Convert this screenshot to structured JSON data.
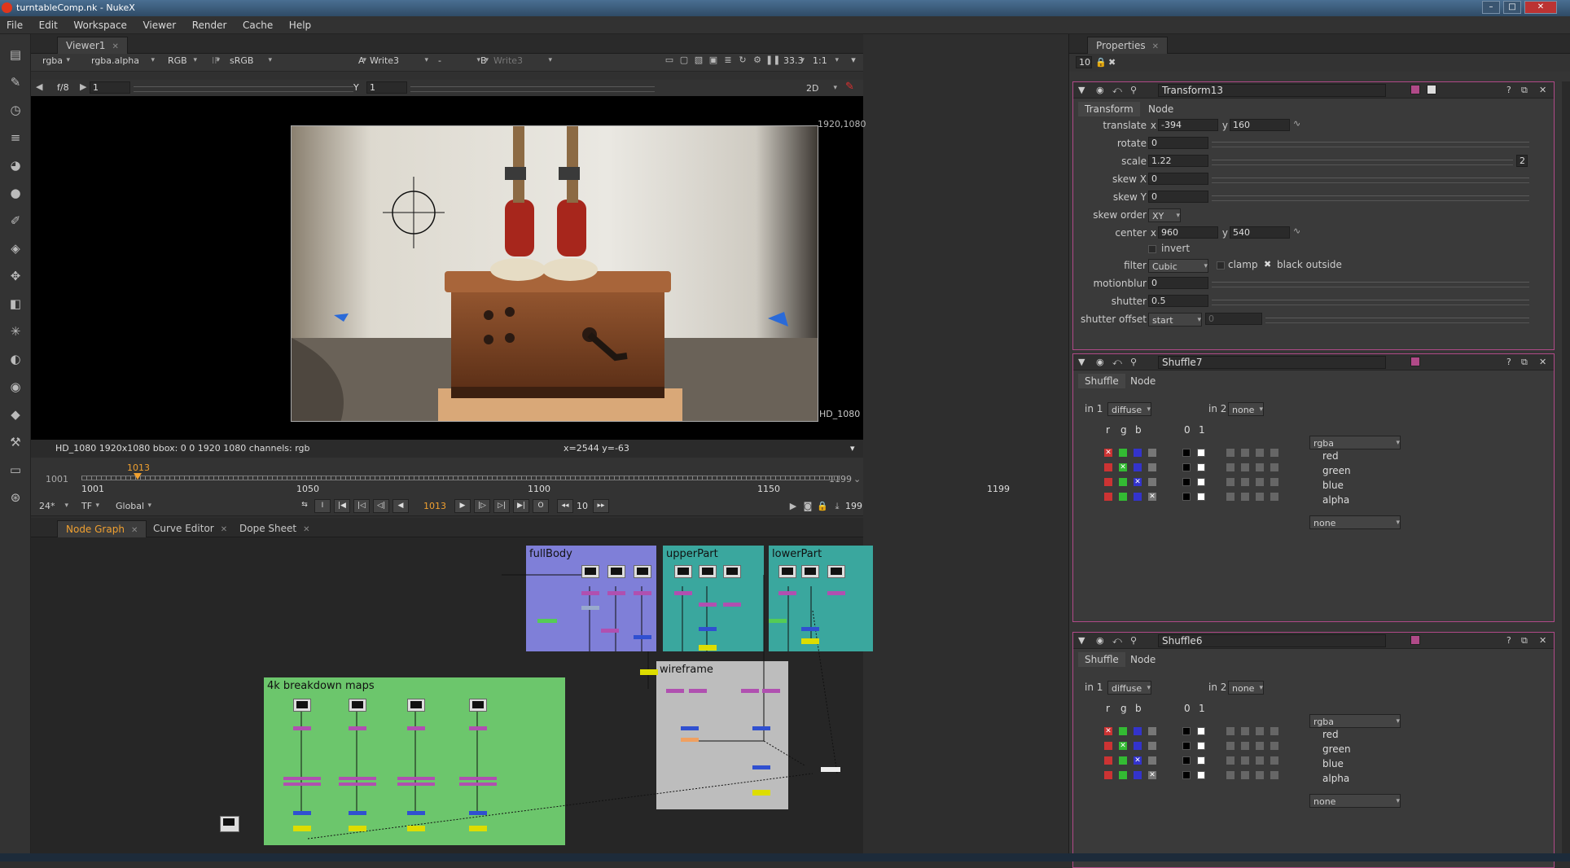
{
  "window": {
    "title": "turntableComp.nk - NukeX",
    "controls": [
      "–",
      "□",
      "✕"
    ]
  },
  "menu": [
    "File",
    "Edit",
    "Workspace",
    "Viewer",
    "Render",
    "Cache",
    "Help"
  ],
  "viewer": {
    "tab": "Viewer1",
    "channels": "rgba",
    "alpha": "rgba.alpha",
    "color": "RGB",
    "ip": "IP",
    "lut": "sRGB",
    "a_label": "A",
    "a_input": "Write3",
    "dash": "-",
    "b_label": "B",
    "b_input": "Write3",
    "zoom": "33.3",
    "ratio": "1:1",
    "fstop": "f/8",
    "gain": "1",
    "gamma_label": "Y",
    "gamma": "1",
    "view_mode": "2D",
    "format_top": "1920,1080",
    "format_bottom": "HD_1080",
    "info": "HD_1080 1920x1080  bbox: 0 0 1920 1080 channels: rgb",
    "coords": "x=2544 y=-63"
  },
  "timeline": {
    "start": "1001",
    "end": "1199",
    "current": "1013",
    "ticks": [
      "1001",
      "1050",
      "1100",
      "1150",
      "1199"
    ],
    "fps": "24*",
    "tf": "TF",
    "range_mode": "Global",
    "increment": "10",
    "frame_count": "199"
  },
  "bottom_tabs": [
    "Node Graph",
    "Curve Editor",
    "Dope Sheet"
  ],
  "backdrops": [
    {
      "label": "fullBody",
      "color": "#7f7fd8"
    },
    {
      "label": "upperPart",
      "color": "#3aa79e"
    },
    {
      "label": "lowerPart",
      "color": "#3aa79e"
    },
    {
      "label": "wireframe",
      "color": "#bdbdbd"
    },
    {
      "label": "4k breakdown maps",
      "color": "#6cc66c"
    }
  ],
  "properties": {
    "title": "Properties",
    "count": "10",
    "transform": {
      "name": "Transform13",
      "tabs": [
        "Transform",
        "Node"
      ],
      "translate_label": "translate",
      "translate_x": "-394",
      "translate_y": "160",
      "rotate_label": "rotate",
      "rotate": "0",
      "scale_label": "scale",
      "scale": "1.22",
      "scale_dim": "2",
      "skewx_label": "skew X",
      "skewx": "0",
      "skewy_label": "skew Y",
      "skewy": "0",
      "skeworder_label": "skew order",
      "skeworder": "XY",
      "center_label": "center",
      "center_x": "960",
      "center_y": "540",
      "invert_label": "invert",
      "filter_label": "filter",
      "filter": "Cubic",
      "clamp_label": "clamp",
      "black_outside_label": "black outside",
      "motionblur_label": "motionblur",
      "motionblur": "0",
      "shutter_label": "shutter",
      "shutter": "0.5",
      "shutter_offset_label": "shutter offset",
      "shutter_offset": "start",
      "shutter_offset_value": "0",
      "x": "x",
      "y": "y"
    },
    "shuffles": [
      {
        "name": "Shuffle7",
        "tabs": [
          "Shuffle",
          "Node"
        ],
        "in1": "diffuse",
        "in2": "none",
        "out1": "rgba",
        "out2": "none"
      },
      {
        "name": "Shuffle6",
        "tabs": [
          "Shuffle",
          "Node"
        ],
        "in1": "diffuse",
        "in2": "none",
        "out1": "rgba",
        "out2": "none"
      }
    ],
    "shuffle_labels": {
      "in1": "in 1",
      "in2": "in 2",
      "r": "r",
      "g": "g",
      "b": "b",
      "zero": "0",
      "one": "1",
      "channels": [
        "red",
        "green",
        "blue",
        "alpha"
      ]
    }
  }
}
